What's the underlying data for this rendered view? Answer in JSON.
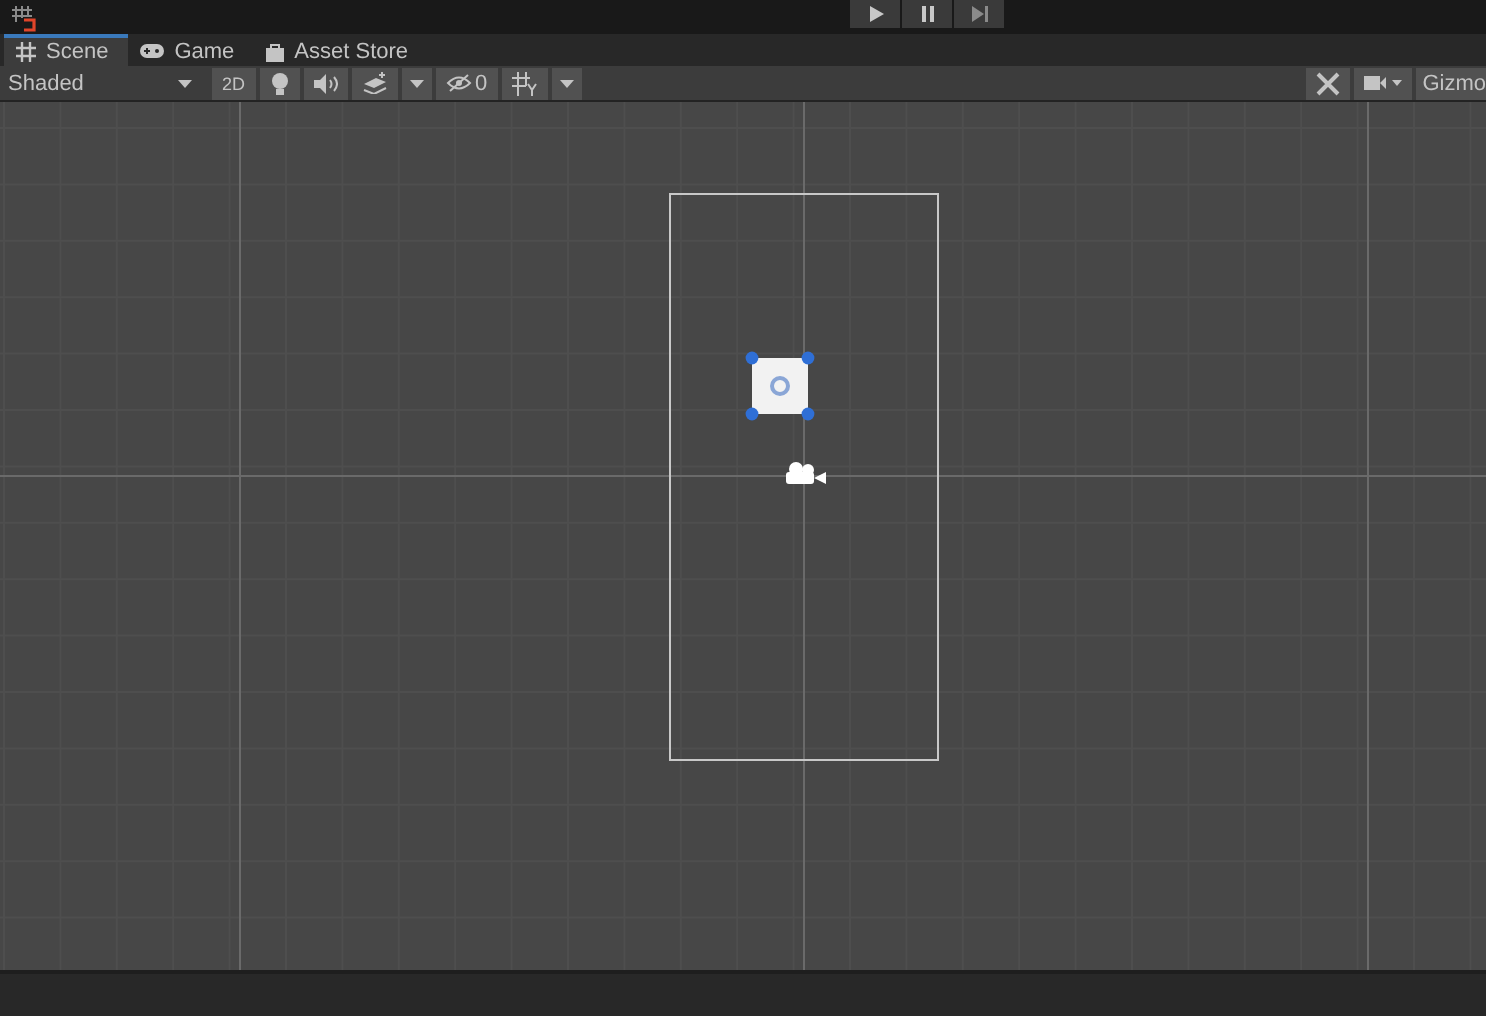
{
  "tabs": [
    {
      "label": "Scene",
      "kind": "scene",
      "selected": true
    },
    {
      "label": "Game",
      "kind": "game",
      "selected": false
    },
    {
      "label": "Asset Store",
      "kind": "store",
      "selected": false
    }
  ],
  "toolbar": {
    "draw_mode": "Shaded",
    "mode_2d": {
      "label": "2D",
      "on": false
    },
    "hidden_count": "0",
    "gizmos": "Gizmo"
  }
}
